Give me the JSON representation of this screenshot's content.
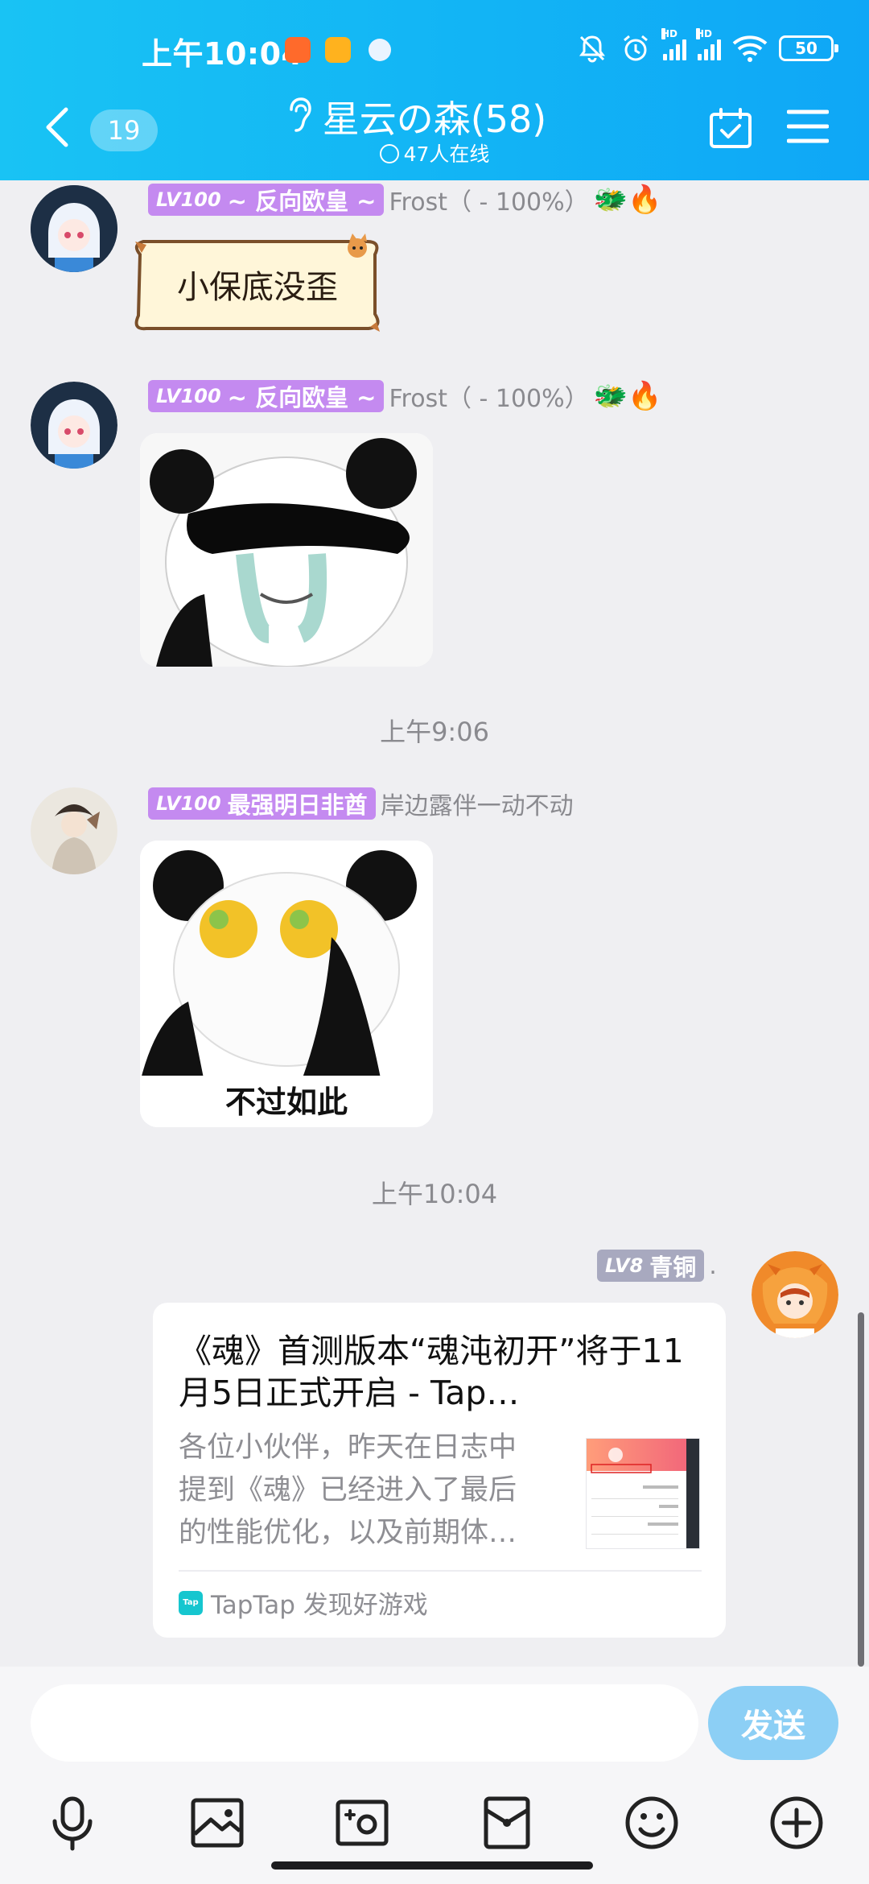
{
  "status_bar": {
    "time": "上午10:04",
    "battery": "50",
    "hd1": "HD",
    "hd2": "HD"
  },
  "header": {
    "unread_count": "19",
    "title": "星云の森(58)",
    "online": "47人在线"
  },
  "messages": [
    {
      "level": "LV100",
      "title": "~ 反向欧皇 ~",
      "name": "Frost（ - 100%）",
      "badges": "🐲🔥",
      "sticker_text": "小保底没歪"
    },
    {
      "level": "LV100",
      "title": "~ 反向欧皇 ~",
      "name": "Frost（ - 100%）",
      "badges": "🐲🔥"
    },
    {
      "timestamp": "上午9:06"
    },
    {
      "level": "LV100",
      "title": "最强明日非酋",
      "name": "岸边露伴一动不动",
      "sticker_text": "不过如此"
    },
    {
      "timestamp": "上午10:04"
    },
    {
      "level": "LV8",
      "title": "青铜",
      "name": "."
    }
  ],
  "link_card": {
    "title": "《魂》首测版本“魂沌初开”将于11月5日正式开启 - Tap…",
    "description": "各位小伙伴，昨天在日志中提到《魂》已经进入了最后的性能优化，以及前期体…",
    "source": "TapTap 发现好游戏",
    "logo_text": "Tap"
  },
  "input": {
    "placeholder": "",
    "send_label": "发送"
  },
  "colors": {
    "header_start": "#19c3f4",
    "header_end": "#0fa7f6",
    "lv_purple": "#c48af0",
    "lv_gray": "#a8a9bf",
    "send_button": "#8ccff5"
  },
  "icons": [
    "back-icon",
    "ear-icon",
    "check-circle-icon",
    "calendar-check-icon",
    "menu-icon",
    "microphone-icon",
    "image-icon",
    "camera-icon",
    "red-packet-icon",
    "emoji-icon",
    "plus-icon"
  ]
}
